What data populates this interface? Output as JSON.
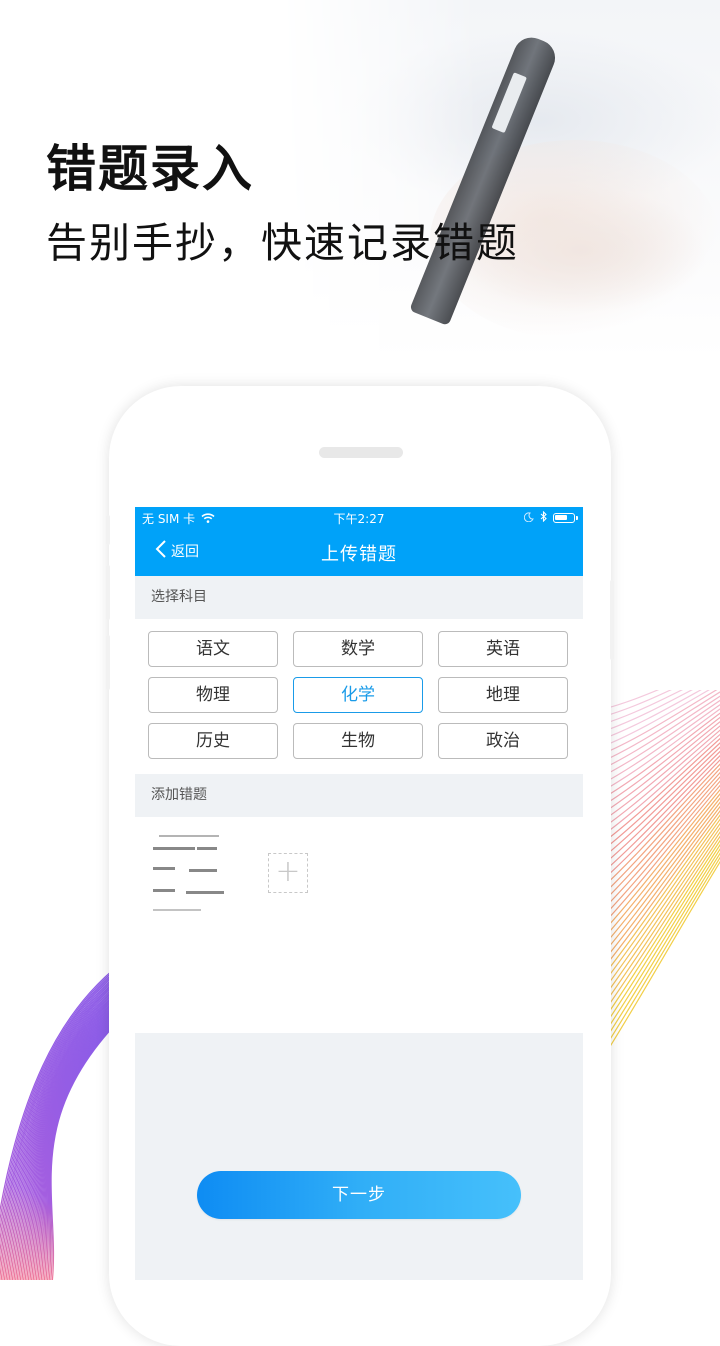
{
  "hero": {
    "title": "错题录入",
    "subtitle": "告别手抄，快速记录错题"
  },
  "status_bar": {
    "carrier": "无 SIM 卡",
    "time": "下午2:27",
    "icons": [
      "wifi-icon",
      "moon-icon",
      "bluetooth-icon",
      "battery-icon"
    ]
  },
  "nav": {
    "back_label": "返回",
    "title": "上传错题"
  },
  "subject_section": {
    "header": "选择科目",
    "subjects": [
      {
        "label": "语文",
        "selected": false
      },
      {
        "label": "数学",
        "selected": false
      },
      {
        "label": "英语",
        "selected": false
      },
      {
        "label": "物理",
        "selected": false
      },
      {
        "label": "化学",
        "selected": true
      },
      {
        "label": "地理",
        "selected": false
      },
      {
        "label": "历史",
        "selected": false
      },
      {
        "label": "生物",
        "selected": false
      },
      {
        "label": "政治",
        "selected": false
      }
    ]
  },
  "question_section": {
    "header": "添加错题",
    "add_icon": "plus-icon"
  },
  "footer": {
    "next_label": "下一步"
  },
  "colors": {
    "primary": "#00a2f9",
    "selected": "#1a9be8",
    "button_gradient_start": "#0e8cf3",
    "button_gradient_end": "#46c0fb",
    "section_bg": "#eff2f5"
  }
}
